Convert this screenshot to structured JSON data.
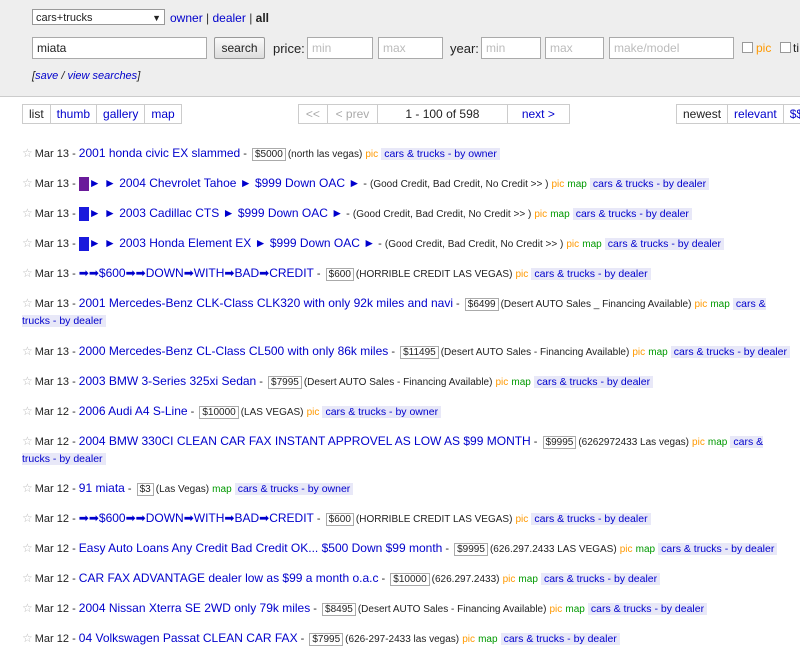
{
  "search": {
    "category_select": "cars+trucks",
    "owner_link": "owner",
    "dealer_link": "dealer",
    "all_label": "all",
    "query_value": "miata",
    "search_button": "search",
    "price_label": "price:",
    "price_min_ph": "min",
    "price_max_ph": "max",
    "year_label": "year:",
    "year_min_ph": "min",
    "year_max_ph": "max",
    "make_model_ph": "make/model",
    "pic_label": "pic",
    "save_link": "save",
    "view_link": "view searches",
    "save_suffix": " / ",
    "bracket_open": "[",
    "bracket_close": "]"
  },
  "views": {
    "list": "list",
    "thumb": "thumb",
    "gallery": "gallery",
    "map": "map"
  },
  "pager": {
    "first": "<<",
    "prev": "< prev",
    "range": "1 - 100 of 598",
    "next": "next >"
  },
  "sort": {
    "newest": "newest",
    "relevant": "relevant",
    "price": "$$"
  },
  "listings": [
    {
      "date": "Mar 13",
      "title": "2001 honda civic EX slammed",
      "price": "$5000",
      "loc": "(north las vegas)",
      "pic": "pic",
      "map": "",
      "cat": "cars & trucks - by owner"
    },
    {
      "date": "Mar 13",
      "title": "► ► 2004 Chevrolet Tahoe ► $999 Down OAC ►",
      "price": "",
      "loc": "(Good Credit, Bad Credit, No Credit >> )",
      "pic": "pic",
      "map": "map",
      "cat": "cars & trucks - by dealer",
      "color": "#6a1b9a"
    },
    {
      "date": "Mar 13",
      "title": "► ► 2003 Cadillac CTS ► $999 Down OAC ►",
      "price": "",
      "loc": "(Good Credit, Bad Credit, No Credit >> )",
      "pic": "pic",
      "map": "map",
      "cat": "cars & trucks - by dealer",
      "color": "#1a1adc"
    },
    {
      "date": "Mar 13",
      "title": "► ► 2003 Honda Element EX ► $999 Down OAC ►",
      "price": "",
      "loc": "(Good Credit, Bad Credit, No Credit >> )",
      "pic": "pic",
      "map": "map",
      "cat": "cars & trucks - by dealer",
      "color": "#1a1adc"
    },
    {
      "date": "Mar 13",
      "title": "➡➡$600➡➡DOWN➡WITH➡BAD➡CREDIT",
      "price": "$600",
      "loc": "(HORRIBLE CREDIT LAS VEGAS)",
      "pic": "pic",
      "map": "",
      "cat": "cars & trucks - by dealer"
    },
    {
      "date": "Mar 13",
      "title": "2001 Mercedes-Benz CLK-Class CLK320 with only 92k miles and navi",
      "price": "$6499",
      "loc": "(Desert AUTO Sales _ Financing Available)",
      "pic": "pic",
      "map": "map",
      "cat": "cars & trucks - by dealer"
    },
    {
      "date": "Mar 13",
      "title": "2000 Mercedes-Benz CL-Class CL500 with only 86k miles",
      "price": "$11495",
      "loc": "(Desert AUTO Sales - Financing Available)",
      "pic": "pic",
      "map": "map",
      "cat": "cars & trucks - by dealer"
    },
    {
      "date": "Mar 13",
      "title": "2003 BMW 3-Series 325xi Sedan",
      "price": "$7995",
      "loc": "(Desert AUTO Sales - Financing Available)",
      "pic": "pic",
      "map": "map",
      "cat": "cars & trucks - by dealer"
    },
    {
      "date": "Mar 12",
      "title": "2006 Audi A4 S-Line",
      "price": "$10000",
      "loc": "(LAS VEGAS)",
      "pic": "pic",
      "map": "",
      "cat": "cars & trucks - by owner"
    },
    {
      "date": "Mar 12",
      "title": "2004 BMW 330CI CLEAN CAR FAX INSTANT APPROVEL AS LOW AS $99 MONTH",
      "price": "$9995",
      "loc": "(6262972433 Las vegas)",
      "pic": "pic",
      "map": "map",
      "cat": "cars & trucks - by dealer"
    },
    {
      "date": "Mar 12",
      "title": "91 miata",
      "price": "$3",
      "loc": "(Las Vegas)",
      "pic": "",
      "map": "map",
      "cat": "cars & trucks - by owner"
    },
    {
      "date": "Mar 12",
      "title": "➡➡$600➡➡DOWN➡WITH➡BAD➡CREDIT",
      "price": "$600",
      "loc": "(HORRIBLE CREDIT LAS VEGAS)",
      "pic": "pic",
      "map": "",
      "cat": "cars & trucks - by dealer"
    },
    {
      "date": "Mar 12",
      "title": "Easy Auto Loans Any Credit Bad Credit OK... $500 Down $99 month",
      "price": "$9995",
      "loc": "(626.297.2433 LAS VEGAS)",
      "pic": "pic",
      "map": "map",
      "cat": "cars & trucks - by dealer"
    },
    {
      "date": "Mar 12",
      "title": "CAR FAX ADVANTAGE dealer low as $99 a month o.a.c",
      "price": "$10000",
      "loc": "(626.297.2433)",
      "pic": "pic",
      "map": "map",
      "cat": "cars & trucks - by dealer"
    },
    {
      "date": "Mar 12",
      "title": "2004 Nissan Xterra SE 2WD only 79k miles",
      "price": "$8495",
      "loc": "(Desert AUTO Sales - Financing Available)",
      "pic": "pic",
      "map": "map",
      "cat": "cars & trucks - by dealer"
    },
    {
      "date": "Mar 12",
      "title": "04 Volkswagen Passat CLEAN CAR FAX",
      "price": "$7995",
      "loc": "(626-297-2433 las vegas)",
      "pic": "pic",
      "map": "map",
      "cat": "cars & trucks - by dealer"
    }
  ]
}
